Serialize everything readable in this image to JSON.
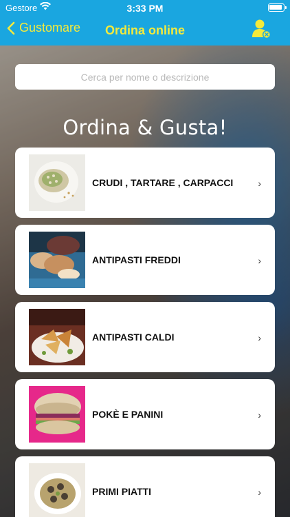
{
  "status_bar": {
    "carrier": "Gestore",
    "time": "3:33 PM"
  },
  "nav": {
    "back_label": "Gustomare",
    "title": "Ordina online"
  },
  "search": {
    "placeholder": "Cerca per nome o descrizione"
  },
  "headline": "Ordina & Gusta!",
  "categories": [
    {
      "label": "CRUDI , TARTARE , CARPACCI",
      "icon": "chevron-right"
    },
    {
      "label": "ANTIPASTI FREDDI",
      "icon": "chevron-right"
    },
    {
      "label": "ANTIPASTI CALDI",
      "icon": "chevron-right"
    },
    {
      "label": "POKÈ E PANINI",
      "icon": "chevron-right"
    },
    {
      "label": "PRIMI PIATTI",
      "icon": "chevron-right"
    }
  ],
  "chevron_glyph": "›",
  "colors": {
    "nav_bar": "#1aa6e0",
    "nav_text": "#f4ea3c"
  }
}
